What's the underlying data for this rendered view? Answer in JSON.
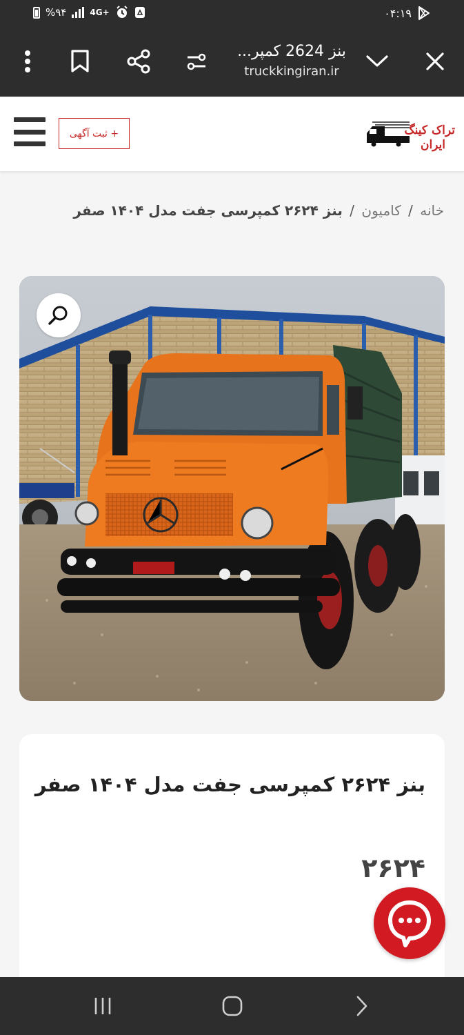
{
  "status_bar": {
    "time": "۰۴:۱۹",
    "battery": "%۹۴",
    "network": "4G+"
  },
  "browser": {
    "tab_title": "بنز 2624 کمپر...",
    "url_host": "truckkingiran.ir"
  },
  "header": {
    "post_ad_label": "+ ثبت آگهی",
    "logo_line1": "تراک کینگ",
    "logo_line2": "ایران"
  },
  "breadcrumb": {
    "home": "خانه",
    "separator": "/",
    "category": "کامیون",
    "current": "بنز ۲۶۲۴ کمپرسی جفت مدل ۱۴۰۴ صفر"
  },
  "product": {
    "title": "بنز ۲۶۲۴ کمپرسی جفت مدل ۱۴۰۴ صفر",
    "model": "۲۶۲۴"
  },
  "colors": {
    "brand_red": "#c62828",
    "chat_red": "#d11a22",
    "toolbar_dark": "#2d2d2d",
    "truck_orange": "#e8731d"
  },
  "icons": {
    "close": "close-icon",
    "dropdown": "chevron-down-icon",
    "filter": "tune-icon",
    "share": "share-icon",
    "bookmark": "bookmark-icon",
    "more": "more-vertical-icon",
    "zoom": "search-icon",
    "chat": "chat-bubble-icon",
    "menu": "hamburger-icon"
  }
}
